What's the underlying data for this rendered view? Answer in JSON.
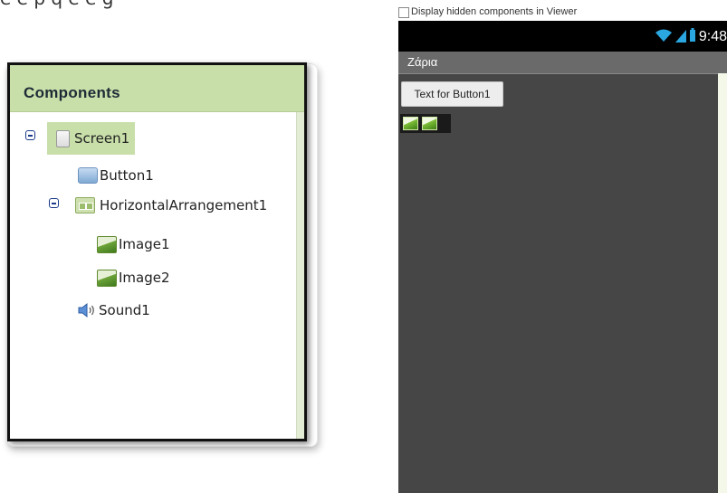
{
  "header_caption": "e  e p   q    e     e  g",
  "components_panel": {
    "title": "Components",
    "items": [
      {
        "label": "Screen1",
        "icon": "screen-icon",
        "expanded": true,
        "selected": true
      },
      {
        "label": "Button1",
        "icon": "button-icon"
      },
      {
        "label": "HorizontalArrangement1",
        "icon": "horizontal-arrangement-icon",
        "expanded": true
      },
      {
        "label": "Image1",
        "icon": "image-icon"
      },
      {
        "label": "Image2",
        "icon": "image-icon"
      },
      {
        "label": "Sound1",
        "icon": "sound-icon"
      }
    ]
  },
  "viewer": {
    "hidden_components_label": "Display hidden components in Viewer",
    "status_time": "9:48",
    "screen_title": "Ζάρια",
    "button_text": "Text for Button1"
  },
  "colors": {
    "panel_header": "#c8dfa9",
    "phone_background": "#464646",
    "statusbar": "#000000",
    "titlebar": "#6a6a6a"
  }
}
